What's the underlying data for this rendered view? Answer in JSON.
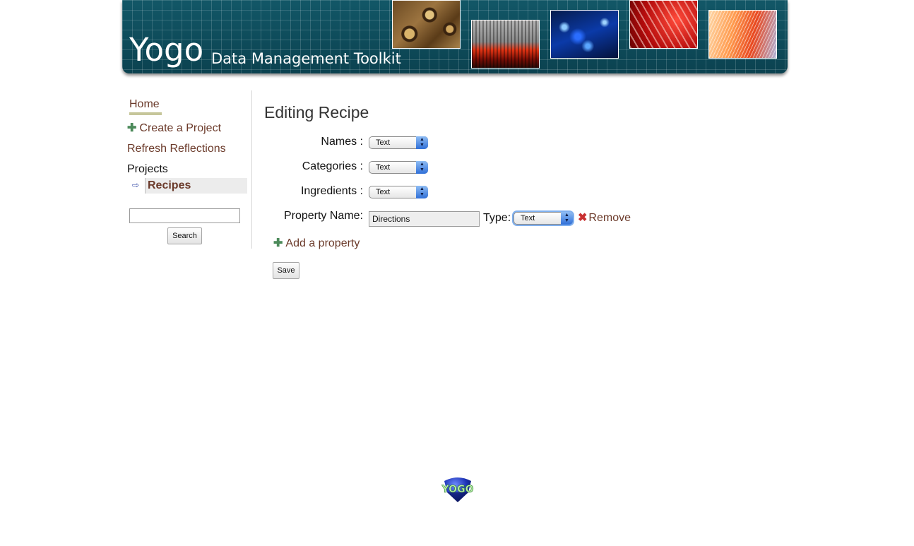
{
  "header": {
    "brand": "Yogo",
    "tagline": "Data Management Toolkit"
  },
  "sidebar": {
    "home": "Home",
    "create_project": "Create a Project",
    "refresh_reflections": "Refresh Reflections",
    "projects_heading": "Projects",
    "projects": [
      {
        "label": "Recipes",
        "selected": true
      }
    ],
    "search": {
      "value": "",
      "placeholder": "",
      "button_label": "Search"
    }
  },
  "main": {
    "title": "Editing Recipe",
    "properties": [
      {
        "label": "Names :",
        "type": "Text"
      },
      {
        "label": "Categories :",
        "type": "Text"
      },
      {
        "label": "Ingredients :",
        "type": "Text"
      }
    ],
    "new_property": {
      "label": "Property Name:",
      "value": "Directions",
      "type_label": "Type:",
      "type": "Text",
      "remove_label": "Remove"
    },
    "add_property_label": "Add a property",
    "save_label": "Save"
  },
  "footer": {
    "logo_text": "YOGO"
  },
  "colors": {
    "banner": "#0f4c5a",
    "link": "#6b3a2a",
    "plus_icon": "#4c8a5a",
    "remove_icon": "#c93030",
    "select_arrow": "#2f6fd8"
  },
  "icons": {
    "plus": "plus-icon",
    "remove": "close-x-icon",
    "selected_project": "arrow-right-icon",
    "select_arrows": "updown-arrows-icon"
  }
}
